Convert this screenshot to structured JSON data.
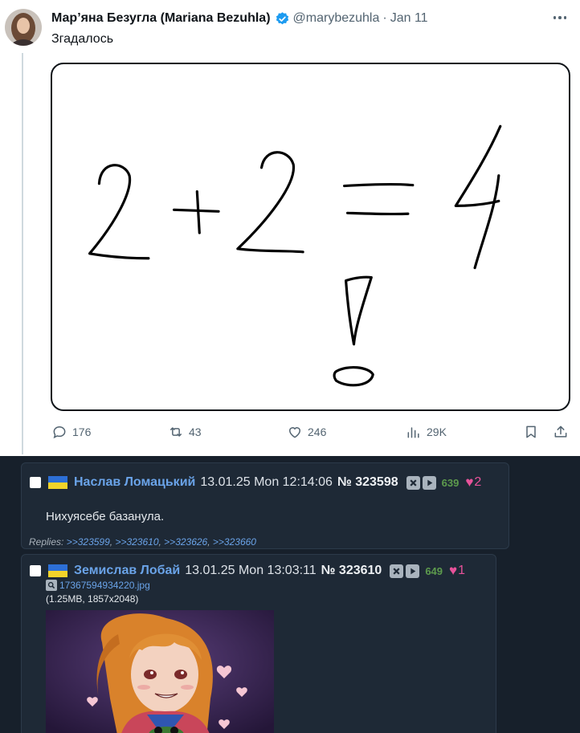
{
  "tweet": {
    "author_name": "Мар’яна Безугла (Mariana Bezuhla)",
    "handle": "@marybezuhla",
    "separator": "·",
    "date": "Jan 11",
    "text": "Згадалось",
    "actions": {
      "replies": "176",
      "retweets": "43",
      "likes": "246",
      "views": "29K"
    },
    "colors": {
      "verified": "#1d9bf0",
      "muted": "#536471"
    }
  },
  "board": {
    "posts": [
      {
        "name": "Наслав Ломацький",
        "datetime": "13.01.25 Mon 12:14:06",
        "number": "№ 323598",
        "count": "639",
        "likes": "2",
        "body": "Нихуясебе базанула.",
        "replies_label": "Replies:",
        "replies": [
          ">>323599",
          ">>323610",
          ">>323626",
          ">>323660"
        ],
        "reply_separator": ", "
      },
      {
        "name": "Земислав Лобай",
        "datetime": "13.01.25 Mon 13:03:11",
        "number": "№ 323610",
        "count": "649",
        "likes": "1",
        "file_name": "17367594934220.jpg",
        "file_meta": "(1.25MB, 1857x2048)"
      }
    ],
    "colors": {
      "background": "#17202b",
      "post_bg": "#1e2936",
      "name": "#6aa3e8",
      "count": "#5d9b4d",
      "heart": "#e8529a"
    }
  }
}
